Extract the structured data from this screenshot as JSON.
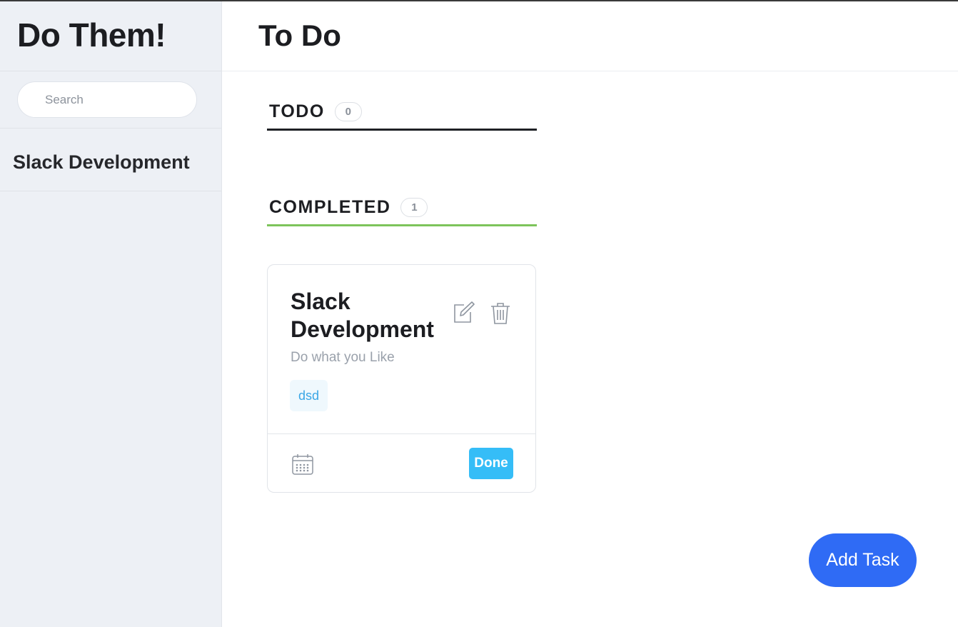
{
  "app": {
    "title": "Do Them!"
  },
  "sidebar": {
    "search": {
      "placeholder": "Search",
      "value": ""
    },
    "projects": [
      {
        "label": "Slack Development"
      }
    ]
  },
  "main": {
    "title": "To Do",
    "sections": {
      "todo": {
        "title": "TODO",
        "count": "0",
        "accent": "#1f2125"
      },
      "completed": {
        "title": "COMPLETED",
        "count": "1",
        "accent": "#7dc45a"
      }
    },
    "card": {
      "title": "Slack Development",
      "description": "Do what you Like",
      "tag": "dsd",
      "done_label": "Done",
      "icons": [
        "edit-icon",
        "trash-icon",
        "calendar-icon"
      ]
    },
    "add_task_label": "Add Task"
  },
  "colors": {
    "primary": "#2f6bf5",
    "done": "#35bdf7",
    "tag_text": "#3aa6e6",
    "completed_accent": "#7dc45a"
  }
}
